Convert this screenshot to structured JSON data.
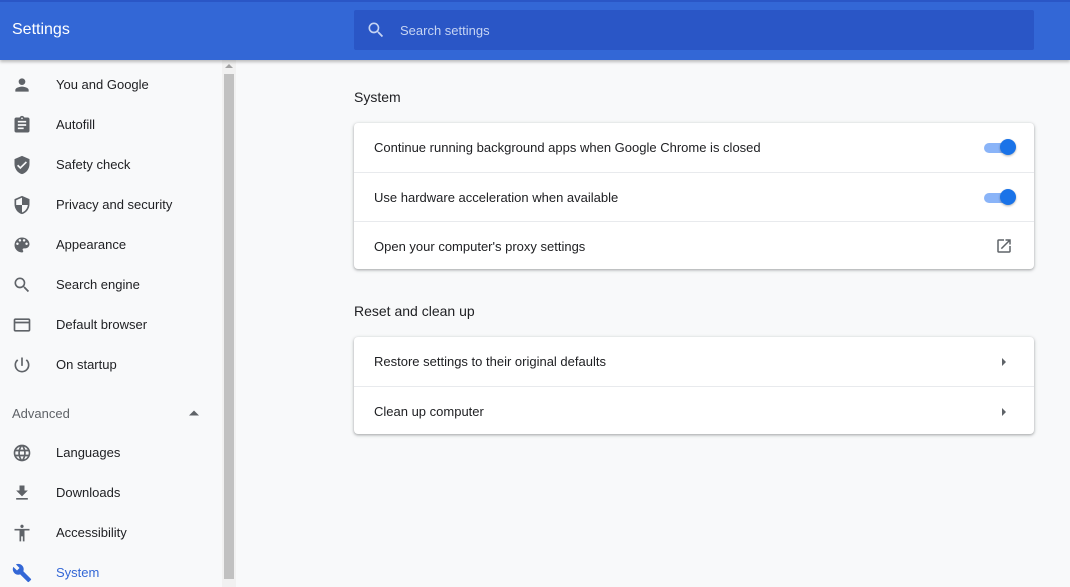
{
  "header": {
    "title": "Settings",
    "search_placeholder": "Search settings"
  },
  "sidebar": {
    "items": [
      {
        "label": "You and Google",
        "icon": "person-icon"
      },
      {
        "label": "Autofill",
        "icon": "clipboard-icon"
      },
      {
        "label": "Safety check",
        "icon": "shield-check-icon"
      },
      {
        "label": "Privacy and security",
        "icon": "shield-icon"
      },
      {
        "label": "Appearance",
        "icon": "palette-icon"
      },
      {
        "label": "Search engine",
        "icon": "search-icon"
      },
      {
        "label": "Default browser",
        "icon": "browser-window-icon"
      },
      {
        "label": "On startup",
        "icon": "power-icon"
      }
    ],
    "advanced_label": "Advanced",
    "advanced_items": [
      {
        "label": "Languages",
        "icon": "globe-icon"
      },
      {
        "label": "Downloads",
        "icon": "download-icon"
      },
      {
        "label": "Accessibility",
        "icon": "accessibility-icon"
      },
      {
        "label": "System",
        "icon": "wrench-icon",
        "active": true
      }
    ]
  },
  "main": {
    "system": {
      "title": "System",
      "rows": [
        {
          "label": "Continue running background apps when Google Chrome is closed",
          "toggle": true
        },
        {
          "label": "Use hardware acceleration when available",
          "toggle": true
        },
        {
          "label": "Open your computer's proxy settings",
          "icon": "open-in-new-icon"
        }
      ]
    },
    "reset": {
      "title": "Reset and clean up",
      "rows": [
        {
          "label": "Restore settings to their original defaults",
          "icon": "arrow-right-icon"
        },
        {
          "label": "Clean up computer",
          "icon": "arrow-right-icon"
        }
      ]
    }
  },
  "colors": {
    "header": "#3367d6",
    "search_bg": "#2a56c6",
    "toggle_on": "#1a73e8",
    "active_text": "#3367d6"
  }
}
